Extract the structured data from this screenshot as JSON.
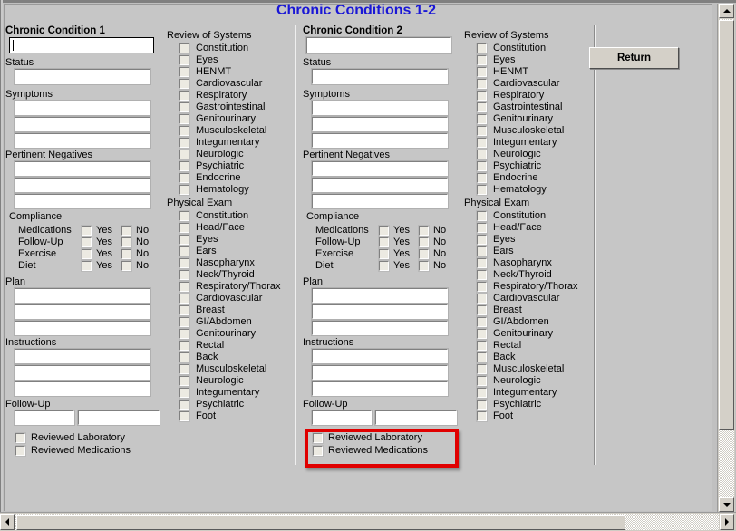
{
  "window": {
    "title": "Chronic Conditions 1-2",
    "title_color": "#1a17d6",
    "background_color": "#c6c6c6"
  },
  "toolbar": {
    "return_label": "Return"
  },
  "labels": {
    "status": "Status",
    "symptoms": "Symptoms",
    "pertinent_negatives": "Pertinent Negatives",
    "compliance": "Compliance",
    "plan": "Plan",
    "instructions": "Instructions",
    "follow_up": "Follow-Up",
    "review_of_systems": "Review of Systems",
    "physical_exam": "Physical Exam",
    "yes": "Yes",
    "no": "No"
  },
  "panels": [
    {
      "heading": "Chronic Condition 1",
      "condition_value": "",
      "condition_focused": true,
      "status_value": "",
      "symptoms_values": [
        "",
        "",
        ""
      ],
      "pertinent_negatives_values": [
        "",
        "",
        ""
      ],
      "compliance_rows": [
        "Medications",
        "Follow-Up",
        "Exercise",
        "Diet"
      ],
      "plan_values": [
        "",
        "",
        ""
      ],
      "instructions_values": [
        "",
        "",
        ""
      ],
      "follow_up_values": [
        "",
        ""
      ],
      "reviewed": [
        "Reviewed Laboratory",
        "Reviewed Medications"
      ],
      "reviewed_highlighted": false
    },
    {
      "heading": "Chronic Condition 2",
      "condition_value": "",
      "condition_focused": false,
      "status_value": "",
      "symptoms_values": [
        "",
        "",
        ""
      ],
      "pertinent_negatives_values": [
        "",
        "",
        ""
      ],
      "compliance_rows": [
        "Medications",
        "Follow-Up",
        "Exercise",
        "Diet"
      ],
      "plan_values": [
        "",
        "",
        ""
      ],
      "instructions_values": [
        "",
        "",
        ""
      ],
      "follow_up_values": [
        "",
        ""
      ],
      "reviewed": [
        "Reviewed Laboratory",
        "Reviewed Medications"
      ],
      "reviewed_highlighted": true
    }
  ],
  "review_of_systems": [
    "Constitution",
    "Eyes",
    "HENMT",
    "Cardiovascular",
    "Respiratory",
    "Gastrointestinal",
    "Genitourinary",
    "Musculoskeletal",
    "Integumentary",
    "Neurologic",
    "Psychiatric",
    "Endocrine",
    "Hematology"
  ],
  "physical_exam": [
    "Constitution",
    "Head/Face",
    "Eyes",
    "Ears",
    "Nasopharynx",
    "Neck/Thyroid",
    "Respiratory/Thorax",
    "Cardiovascular",
    "Breast",
    "GI/Abdomen",
    "Genitourinary",
    "Rectal",
    "Back",
    "Musculoskeletal",
    "Neurologic",
    "Integumentary",
    "Psychiatric",
    "Foot"
  ],
  "annotation": {
    "highlight_color": "#e00000"
  },
  "scrollbars": {
    "vertical": {
      "up_icon": "triangle-up-icon",
      "down_icon": "triangle-down-icon"
    },
    "horizontal": {
      "left_icon": "triangle-left-icon",
      "right_icon": "triangle-right-icon"
    }
  }
}
